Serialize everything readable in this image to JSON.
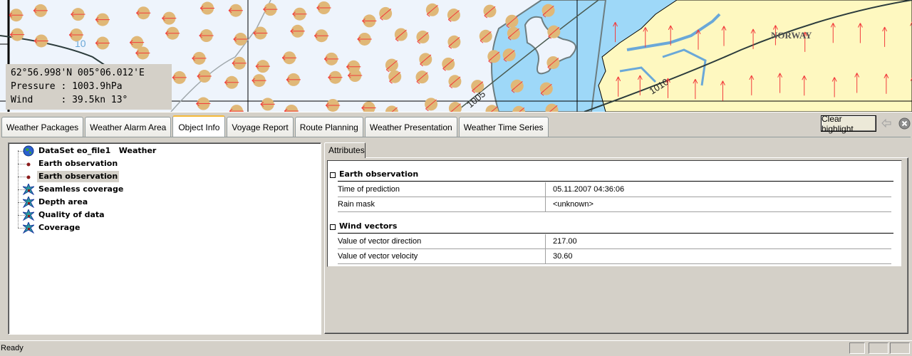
{
  "map": {
    "cursor_info": {
      "position": "62°56.998'N 005°06.012'E",
      "pressure_label": "Pressure",
      "pressure_value": "1003.9hPa",
      "wind_label": "Wind",
      "wind_value": "39.5kn 13°"
    },
    "labels": {
      "country": "NORWAY",
      "isobar_1": "1010",
      "isobar_2": "1005",
      "isobar_3": "10"
    },
    "colors": {
      "sea_open": "#eef4fc",
      "sea_shallow": "#9ed8f8",
      "land": "#fef8c0",
      "wind_arrow": "#f23c3c",
      "observation_marker": "#e0b878"
    }
  },
  "tabs": [
    {
      "label": "Weather Packages",
      "active": false
    },
    {
      "label": "Weather Alarm Area",
      "active": false
    },
    {
      "label": "Object Info",
      "active": true
    },
    {
      "label": "Voyage Report",
      "active": false
    },
    {
      "label": "Route Planning",
      "active": false
    },
    {
      "label": "Weather Presentation",
      "active": false
    },
    {
      "label": "Weather Time Series",
      "active": false
    }
  ],
  "toolbar": {
    "clear_highlight_label": "Clear highlight"
  },
  "tree": {
    "items": [
      {
        "label": "DataSet eo_file1   Weather",
        "icon": "globe-icon",
        "selected": false
      },
      {
        "label": "Earth observation",
        "icon": "dot-icon",
        "selected": false
      },
      {
        "label": "Earth observation",
        "icon": "dot-icon",
        "selected": true
      },
      {
        "label": "Seamless coverage",
        "icon": "star-icon",
        "selected": false
      },
      {
        "label": "Depth area",
        "icon": "star-icon",
        "selected": false
      },
      {
        "label": "Quality of data",
        "icon": "star-icon",
        "selected": false
      },
      {
        "label": "Coverage",
        "icon": "star-icon",
        "selected": false
      }
    ]
  },
  "attributes": {
    "tab_label": "Attributes",
    "groups": [
      {
        "title": "Earth observation",
        "rows": [
          {
            "key": "Time of prediction",
            "value": "05.11.2007  04:36:06"
          },
          {
            "key": "Rain mask",
            "value": "<unknown>"
          }
        ]
      },
      {
        "title": "Wind vectors",
        "rows": [
          {
            "key": "Value of vector direction",
            "value": "217.00"
          },
          {
            "key": "Value of vector velocity",
            "value": "30.60"
          }
        ]
      }
    ]
  },
  "status": {
    "text": "Ready"
  }
}
